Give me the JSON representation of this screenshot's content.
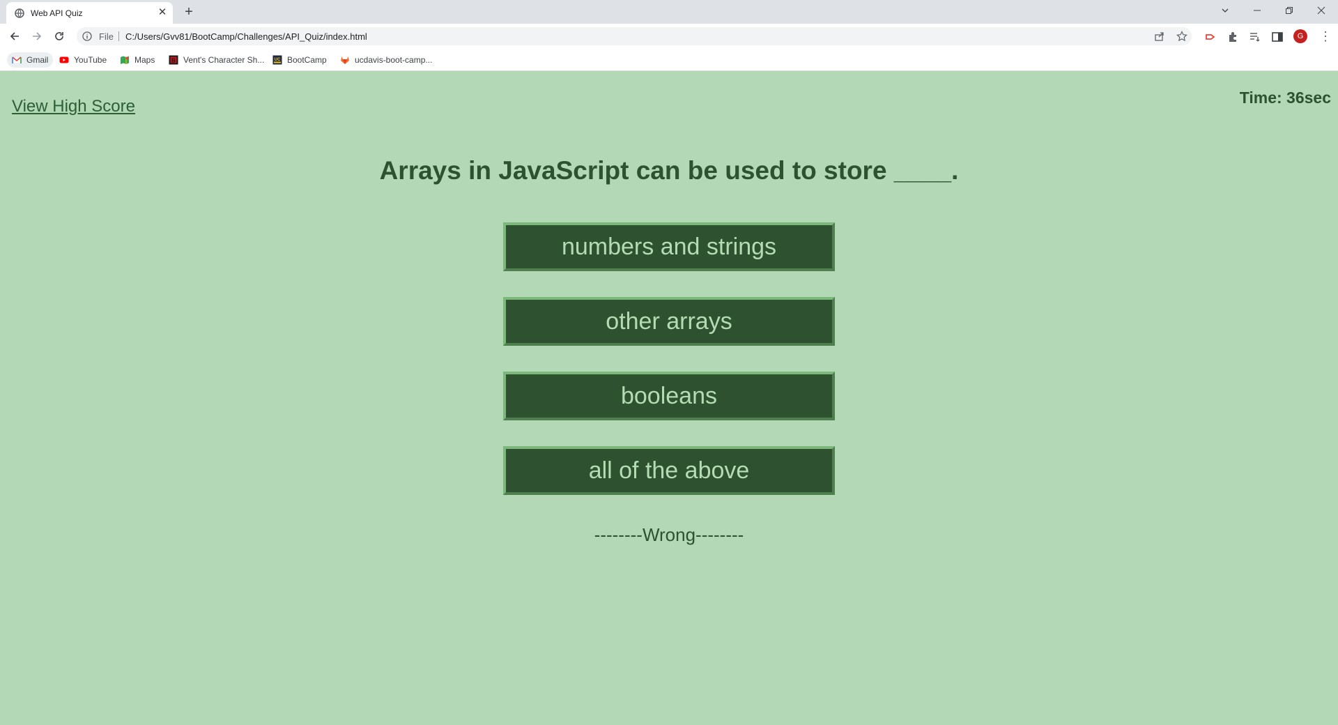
{
  "browser": {
    "tab_title": "Web API Quiz",
    "scheme_label": "File",
    "url": "C:/Users/Gvv81/BootCamp/Challenges/API_Quiz/index.html",
    "avatar_letter": "G",
    "bookmarks": [
      {
        "label": "Gmail",
        "icon": "gmail-icon"
      },
      {
        "label": "YouTube",
        "icon": "youtube-icon"
      },
      {
        "label": "Maps",
        "icon": "maps-icon"
      },
      {
        "label": "Vent's Character Sh...",
        "icon": "vent-icon"
      },
      {
        "label": "BootCamp",
        "icon": "ucdavis-icon"
      },
      {
        "label": "ucdavis-boot-camp...",
        "icon": "gitlab-icon"
      }
    ]
  },
  "quiz": {
    "high_score_link": "View High Score",
    "timer": "Time: 36sec",
    "question": "Arrays in JavaScript can be used to store ____.",
    "answers": [
      "numbers and strings",
      "other arrays",
      "booleans",
      "all of the above"
    ],
    "feedback": "--------Wrong--------"
  },
  "colors": {
    "page_background": "#b2d8b6",
    "button_background": "#2e5230",
    "button_text": "#b4dcb3",
    "heading_text": "#2c5230"
  }
}
